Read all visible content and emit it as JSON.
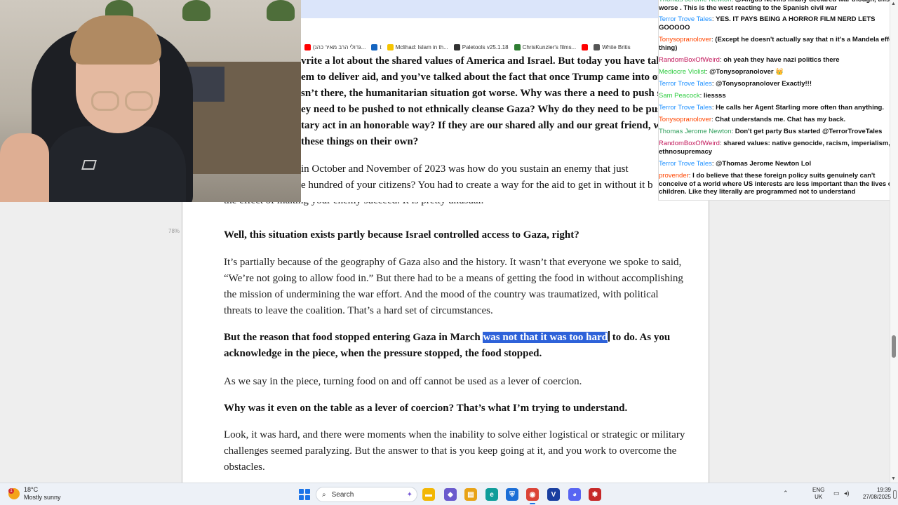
{
  "browser": {
    "bookmarks": [
      {
        "label": "(גדולי הרב מאיר כהנ...",
        "color": "#ff0000"
      },
      {
        "label": "t",
        "color": "#1565c0"
      },
      {
        "label": "Mclihad: Islam in th...",
        "color": "#f5c400"
      },
      {
        "label": "Paletools v25.1.18",
        "color": "#333333"
      },
      {
        "label": "ChrisKunzler's films...",
        "color": "#2e7d32"
      },
      {
        "label": "",
        "color": "#ff0000"
      },
      {
        "label": "White Britis",
        "color": "#555555"
      }
    ],
    "top_lines": [
      "vrite a lot about the shared values of America and Israel. But today you have talk",
      "em to deliver aid, and you’ve talked about the fact that once Trump came into off",
      "sn’t there, the humanitarian situation got worse. Why was there a need to push so",
      "ey need to be pushed to not ethnically cleanse Gaza? Why do they need to be pus",
      "tary act in an honorable way? If they are our shared ally and our great friend, why",
      "these things on their own?",
      "in October and November of 2023 was how do you sustain an enemy that just",
      "e hundred of your citizens? You had to create a way for the aid to get in without it b"
    ]
  },
  "article": {
    "zoom_tag": "78%",
    "partial_line": "the effect of making your enemy succeed. It is pretty unusual.",
    "q1": "Well, this situation exists partly because Israel controlled access to Gaza, right?",
    "a1": "It’s partially because of the geography of Gaza also and the history. It wasn’t that everyone we spoke to said, “We’re not going to allow food in.” But there had to be a means of getting the food in without accomplishing the mission of undermining the war effort. And the mood of the country was traumatized, with political threats to leave the coalition. That’s a hard set of circumstances.",
    "q2_before": "But the reason that food stopped entering Gaza in March ",
    "q2_highlight": "was not that it was too hard",
    "q2_after": " to do. As you acknowledge in the piece, when the pressure stopped, the food stopped.",
    "a2": "As we say in the piece, turning food on and off cannot be used as a lever of coercion.",
    "q3": "Why was it even on the table as a lever of coercion? That’s what I’m trying to understand.",
    "a3": "Look, it was hard, and there were moments when the inability to solve either logistical or strategic or military challenges seemed paralyzing. But the answer to that is you keep going at it, and you work to overcome the obstacles."
  },
  "chat": {
    "messages": [
      {
        "user": "Thomas Jerome Newton",
        "color": "#2e9e5b",
        "text": "@Angus Nevins finally declared war though, this is worse . This is the west reacting to the Spanish civil war"
      },
      {
        "user": "Terror Trove Tales",
        "color": "#1e90ff",
        "text": "YES. IT PAYS BEING A HORROR FILM NERD LETS GOOOOO"
      },
      {
        "user": "Tonysopranolover",
        "color": "#ff4500",
        "text": "(Except he doesn't actually say that n it's a Mandela effect thing)"
      },
      {
        "user": "RandomBoxOfWeird",
        "color": "#c2185b",
        "text": "oh yeah they have nazi politics there"
      },
      {
        "user": "Mediocre Violist",
        "color": "#2ecc40",
        "text": "@Tonysopranolover 👑"
      },
      {
        "user": "Terror Trove Tales",
        "color": "#1e90ff",
        "text": "@Tonysopranolover Exactly!!!"
      },
      {
        "user": "Sam Peacock",
        "color": "#2ecc40",
        "text": "liessss"
      },
      {
        "user": "Terror Trove Tales",
        "color": "#1e90ff",
        "text": "He calls her Agent Starling more often than anything."
      },
      {
        "user": "Tonysopranolover",
        "color": "#ff4500",
        "text": "Chat understands me. Chat has my back."
      },
      {
        "user": "Thomas Jerome Newton",
        "color": "#2e9e5b",
        "text": "Don't get party Bus started @TerrorTroveTales"
      },
      {
        "user": "RandomBoxOfWeird",
        "color": "#c2185b",
        "text": "shared values: native genocide, racism, imperialism, ethnosupremacy"
      },
      {
        "user": "Terror Trove Tales",
        "color": "#1e90ff",
        "text": "@Thomas Jerome Newton Lol"
      },
      {
        "user": "provender",
        "color": "#ff4500",
        "text": "I do believe that these foreign policy suits genuinely can't conceive of a world where US interests are less important than the lives of children. Like they literally are programmed not to understand"
      }
    ]
  },
  "taskbar": {
    "weather_temp": "18°C",
    "weather_desc": "Mostly sunny",
    "weather_badge": "1",
    "search_label": "Search",
    "lang_top": "ENG",
    "lang_bottom": "UK",
    "time": "19:39",
    "date": "27/08/2025",
    "apps": [
      {
        "name": "explorer",
        "color": "#f2b705",
        "glyph": "▬"
      },
      {
        "name": "copilot",
        "color": "#6a5acd",
        "glyph": "◆"
      },
      {
        "name": "files",
        "color": "#e8a317",
        "glyph": "▤"
      },
      {
        "name": "edge",
        "color": "#0f9d9a",
        "glyph": "e"
      },
      {
        "name": "defender",
        "color": "#1b6ed6",
        "glyph": "⛨"
      },
      {
        "name": "chrome",
        "color": "#db4437",
        "glyph": "◉"
      },
      {
        "name": "v-app",
        "color": "#1a3fa0",
        "glyph": "V"
      },
      {
        "name": "discord",
        "color": "#5865f2",
        "glyph": "◕"
      },
      {
        "name": "app-red",
        "color": "#c62828",
        "glyph": "✱"
      }
    ]
  }
}
